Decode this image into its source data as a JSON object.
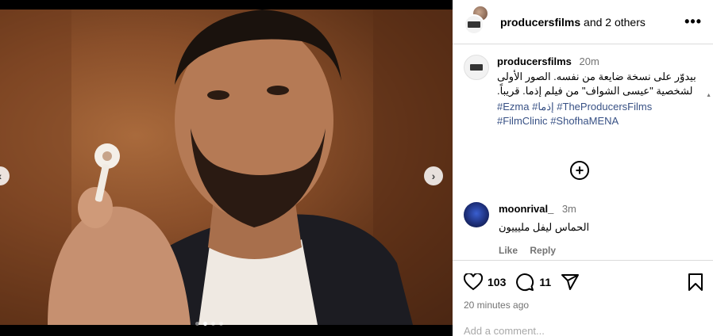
{
  "post": {
    "header_user": "producersfilms",
    "header_others": " and 2 others",
    "more_glyph": "•••",
    "caption_user": "producersfilms",
    "caption_time": "20m",
    "caption_text": "بيدوّر على نسخة ضايعة من نفسه. الصور الأولى لشخصية \"عيسى الشواف\" من فيلم إذما. قريباً.",
    "hashtags": [
      "#Ezma",
      "#إذما",
      "#TheProducersFilms",
      "#FilmClinic",
      "#ShofhaMENA"
    ],
    "likes": "103",
    "comments_count": "11",
    "posted_ago": "20 minutes ago",
    "add_comment_placeholder": "Add a comment..."
  },
  "comment": {
    "user": "moonrival_",
    "time": "3m",
    "text": "الحماس ليفل مليييون",
    "like_label": "Like",
    "reply_label": "Reply"
  },
  "carousel": {
    "total": 4,
    "active": 1
  },
  "icons": {
    "heart": "heart-icon",
    "comment": "comment-icon",
    "share": "share-icon",
    "bookmark": "bookmark-icon",
    "add": "plus-circle-icon",
    "next": "chevron-right-icon",
    "prev": "chevron-left-icon"
  },
  "colors": {
    "link": "#385185",
    "muted": "#737373",
    "border": "#dbdbdb"
  }
}
